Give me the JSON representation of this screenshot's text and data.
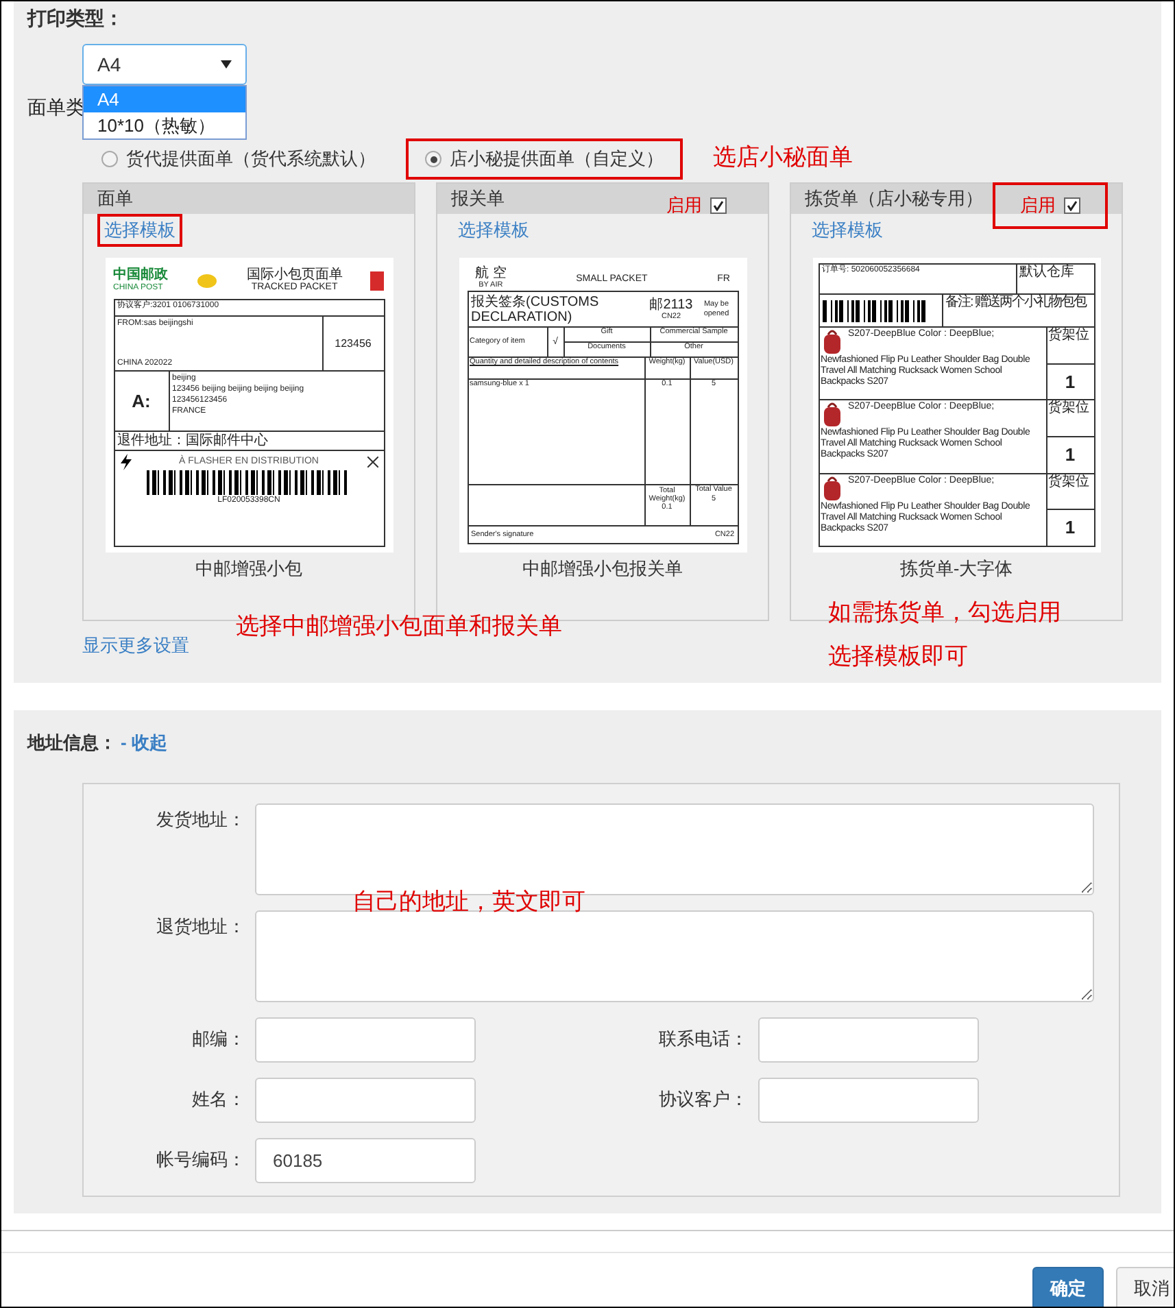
{
  "print_type": {
    "label": "打印类型：",
    "select": {
      "value": "A4"
    },
    "dropdown": [
      {
        "label": "A4",
        "selected": true
      },
      {
        "label": "10*10（热敏）",
        "selected": false
      }
    ]
  },
  "waybill_type": {
    "label": "面单类",
    "options": [
      {
        "label": "货代提供面单（货代系统默认）",
        "selected": false,
        "highlighted": false
      },
      {
        "label": "店小秘提供面单（自定义）",
        "selected": true,
        "highlighted": true
      }
    ]
  },
  "templates": [
    {
      "kind": "postal",
      "title": "面单",
      "link": "选择模板",
      "link_highlighted": true,
      "caption": "中邮增强小包",
      "label": {
        "logo": "中国邮政",
        "logo_en": "CHINA POST",
        "title": "国际小包页面单",
        "title_en": "TRACKED PACKET",
        "account": "协议客户:3201 0106731000",
        "from": "FROM:sas beijingshi",
        "from_zip": "CHINA 202022",
        "code": "123456",
        "to_mark": "A:",
        "to_lines": [
          "beijing",
          "123456 beijing beijing beijing beijing",
          "123456123456",
          "FRANCE"
        ],
        "return": "退件地址：国际邮件中心",
        "notice": "À FLASHER EN DISTRIBUTION",
        "barcode": "LF020053398CN"
      }
    },
    {
      "kind": "customs",
      "title": "报关单",
      "enable": {
        "label": "启用",
        "checked": true,
        "highlighted": false
      },
      "link": "选择模板",
      "link_highlighted": false,
      "caption": "中邮增强小包报关单",
      "label": {
        "air": "航 空",
        "air_en": "BY AIR",
        "packet": "SMALL PACKET",
        "country": "FR",
        "decl": "报关签条(CUSTOMS DECLARATION)",
        "no": "邮2113",
        "cn": "CN22",
        "open": "May be opened",
        "category": "Category of item",
        "gift": "Gift",
        "sample": "Commercial Sample",
        "docs": "Documents",
        "other": "Other",
        "tick": "√",
        "contents": "Quantity and detailed description of contents",
        "weight": "Weight(kg)",
        "value": "Value(USD)",
        "item": "samsung-blue x 1",
        "item_weight": "0.1",
        "item_value": "5",
        "total_weight": "Total Weight(kg)",
        "total_value": "Total Value",
        "sum_weight": "0.1",
        "sum_value": "5",
        "sign": "Sender's signature",
        "sign_cn": "CN22"
      }
    },
    {
      "kind": "picking",
      "title": "拣货单（店小秘专用）",
      "enable": {
        "label": "启用",
        "checked": true,
        "highlighted": true
      },
      "link": "选择模板",
      "link_highlighted": false,
      "caption": "拣货单-大字体",
      "label": {
        "order": "订单号: 502060052356684",
        "warehouse": "默认仓库",
        "note": "备注: 赠送两个小礼物包包",
        "items": [
          {
            "sku": "S207-DeepBlue Color : DeepBlue;",
            "name": "Newfashioned Flip Pu Leather Shoulder Bag Double Travel All Matching Rucksack Women School Backpacks S207",
            "shelf": "货架位",
            "qty": "1"
          },
          {
            "sku": "S207-DeepBlue Color : DeepBlue;",
            "name": "Newfashioned Flip Pu Leather Shoulder Bag Double Travel All Matching Rucksack Women School Backpacks S207",
            "shelf": "货架位",
            "qty": "1"
          },
          {
            "sku": "S207-DeepBlue Color : DeepBlue;",
            "name": "Newfashioned Flip Pu Leather Shoulder Bag Double Travel All Matching Rucksack Women School Backpacks S207",
            "shelf": "货架位",
            "qty": "1"
          }
        ]
      }
    }
  ],
  "more_settings": "显示更多设置",
  "notes": [
    "选店小秘面单",
    "选择中邮增强小包面单和报关单",
    "如需拣货单，勾选启用",
    "选择模板即可",
    "自己的地址，英文即可"
  ],
  "address": {
    "title": "地址信息：",
    "toggle": "- 收起",
    "areas": [
      {
        "label": "发货地址："
      },
      {
        "label": "退货地址："
      }
    ],
    "fields": [
      {
        "label": "邮编："
      },
      {
        "label": "联系电话："
      },
      {
        "label": "姓名："
      },
      {
        "label": "协议客户："
      },
      {
        "label": "帐号编码：",
        "value": "60185"
      }
    ]
  },
  "buttons": [
    {
      "label": "确定",
      "kind": "primary"
    },
    {
      "label": "取消",
      "kind": "default"
    }
  ]
}
